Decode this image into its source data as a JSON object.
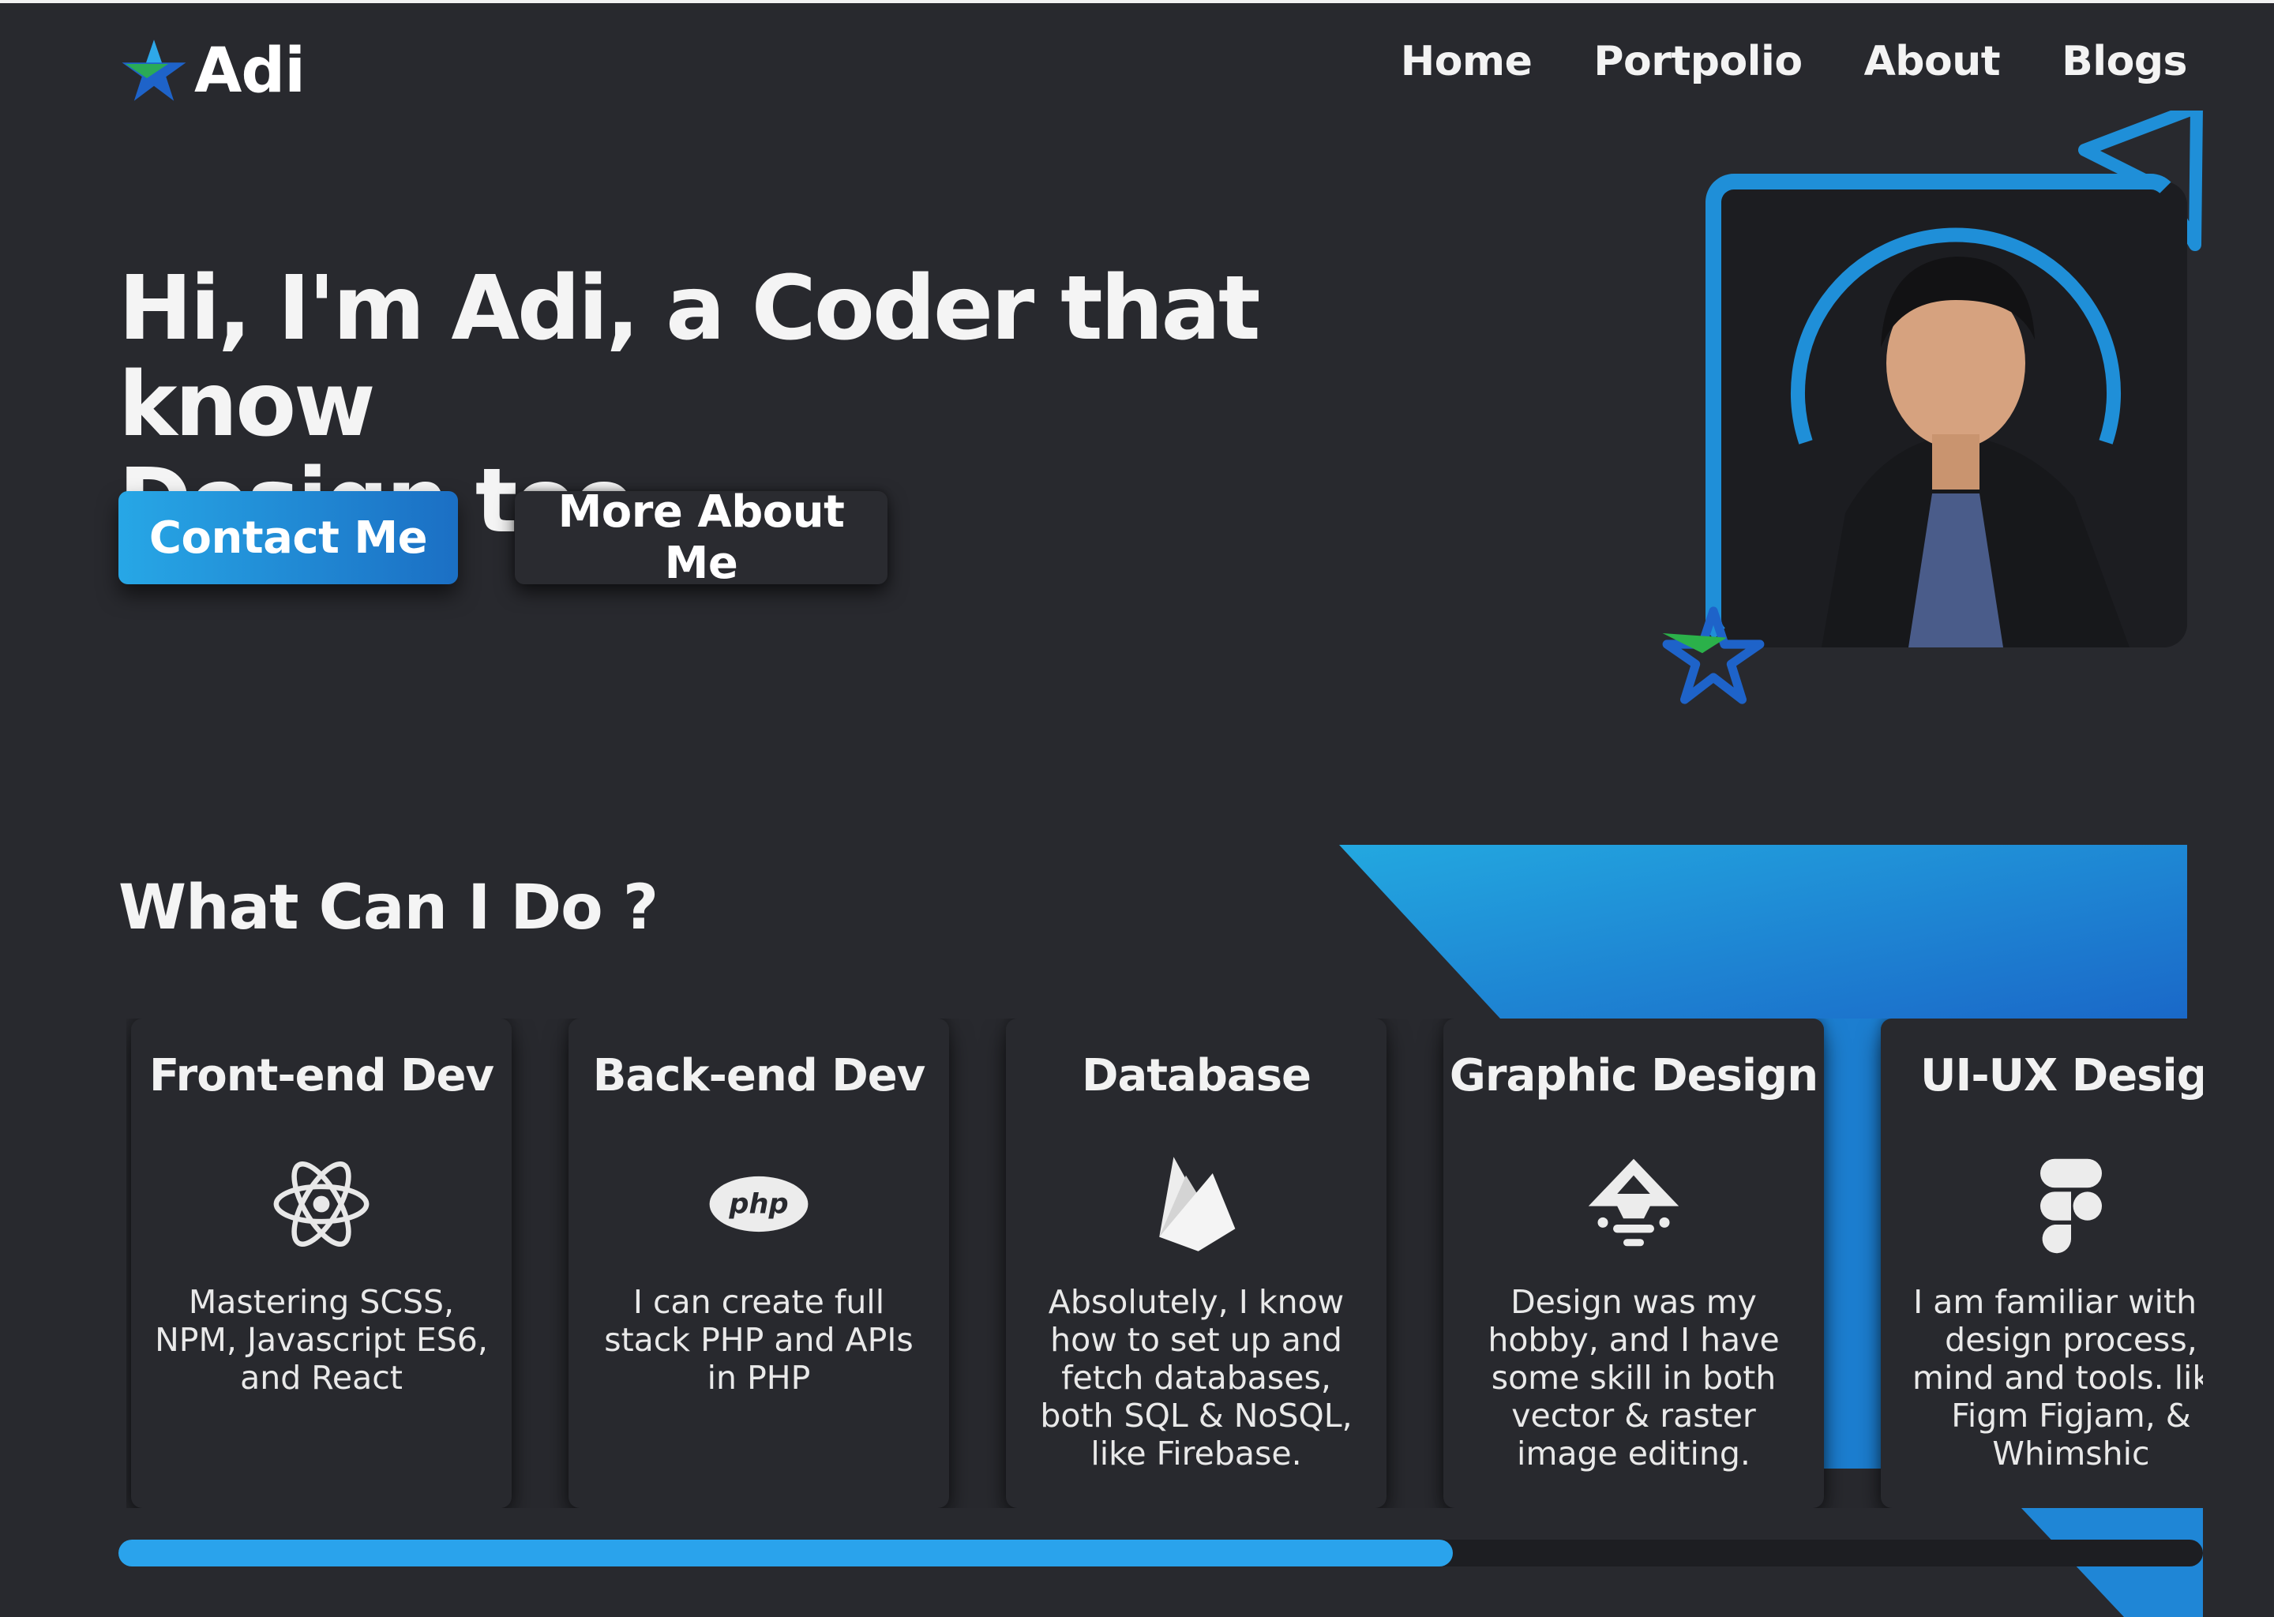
{
  "brand": {
    "name": "Adi",
    "logo_icon": "star-logo-icon"
  },
  "nav": {
    "items": [
      "Home",
      "Portpolio",
      "About",
      "Blogs"
    ]
  },
  "hero": {
    "title_line1": "Hi, I'm Adi, a Coder that know",
    "title_line2": "Design too",
    "primary_button": "Contact Me",
    "secondary_button": "More About Me"
  },
  "colors": {
    "accent": "#1f8fd8",
    "accent_light": "#2aa3ec",
    "background": "#28292e"
  },
  "section": {
    "title": "What Can I Do ?",
    "cards": [
      {
        "title": "Front-end Dev",
        "icon": "react-icon",
        "desc": "Mastering SCSS, NPM, Javascript ES6, and React"
      },
      {
        "title": "Back-end Dev",
        "icon": "php-icon",
        "desc": "I can create full stack PHP and APIs in PHP"
      },
      {
        "title": "Database",
        "icon": "firebase-icon",
        "desc": "Absolutely, I know how to set up and fetch databases, both SQL & NoSQL, like Firebase."
      },
      {
        "title": "Graphic Design",
        "icon": "inkscape-icon",
        "desc": "Design was my hobby, and I have some skill in both vector & raster image editing."
      },
      {
        "title": "UI-UX Desigi",
        "icon": "figma-icon",
        "desc": "I am familiar with tł design process, mind and tools. like Figm Figjam, & Whimshic"
      }
    ]
  },
  "scroll": {
    "progress": 0.64
  }
}
